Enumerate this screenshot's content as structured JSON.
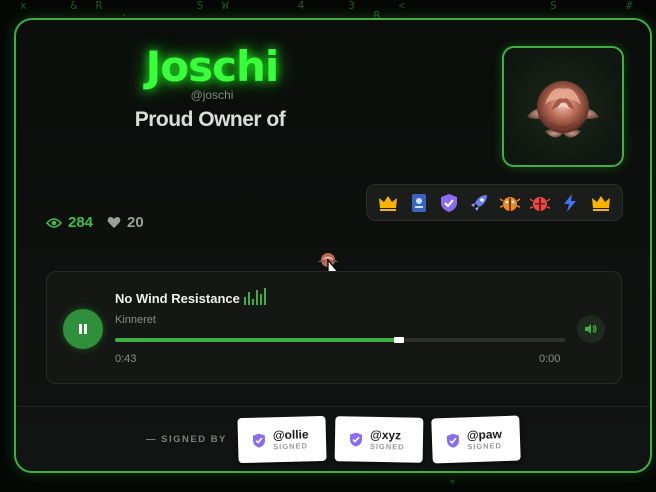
{
  "profile": {
    "name": "Joschi",
    "handle": "@joschi",
    "tagline": "Proud Owner of"
  },
  "avatar": {
    "icon": "rose-icon"
  },
  "badges": [
    {
      "icon": "crown-icon",
      "color": "#f5b400"
    },
    {
      "icon": "id-card-icon",
      "color": "#4a7bd8"
    },
    {
      "icon": "shield-check-icon",
      "color": "#8b6cf0"
    },
    {
      "icon": "rocket-icon",
      "color": "#6d7df2"
    },
    {
      "icon": "bug-orange-icon",
      "color": "#f08a24"
    },
    {
      "icon": "bug-red-icon",
      "color": "#e84a4a"
    },
    {
      "icon": "lightning-icon",
      "color": "#4a6ff0"
    },
    {
      "icon": "crown-icon",
      "color": "#f5b400"
    }
  ],
  "stats": {
    "views": "284",
    "likes": "20"
  },
  "player": {
    "title": "No Wind Resistance",
    "artist": "Kinneret",
    "elapsed": "0:43",
    "remaining": "0:00",
    "progress": 0.63,
    "state": "playing"
  },
  "signatures": {
    "label": "— SIGNED BY",
    "signers": [
      {
        "handle": "@ollie",
        "status": "SIGNED"
      },
      {
        "handle": "@xyz",
        "status": "SIGNED"
      },
      {
        "handle": "@paw",
        "status": "SIGNED"
      }
    ]
  },
  "colors": {
    "accent": "#3fae45",
    "name_glow": "#39ff3a"
  }
}
